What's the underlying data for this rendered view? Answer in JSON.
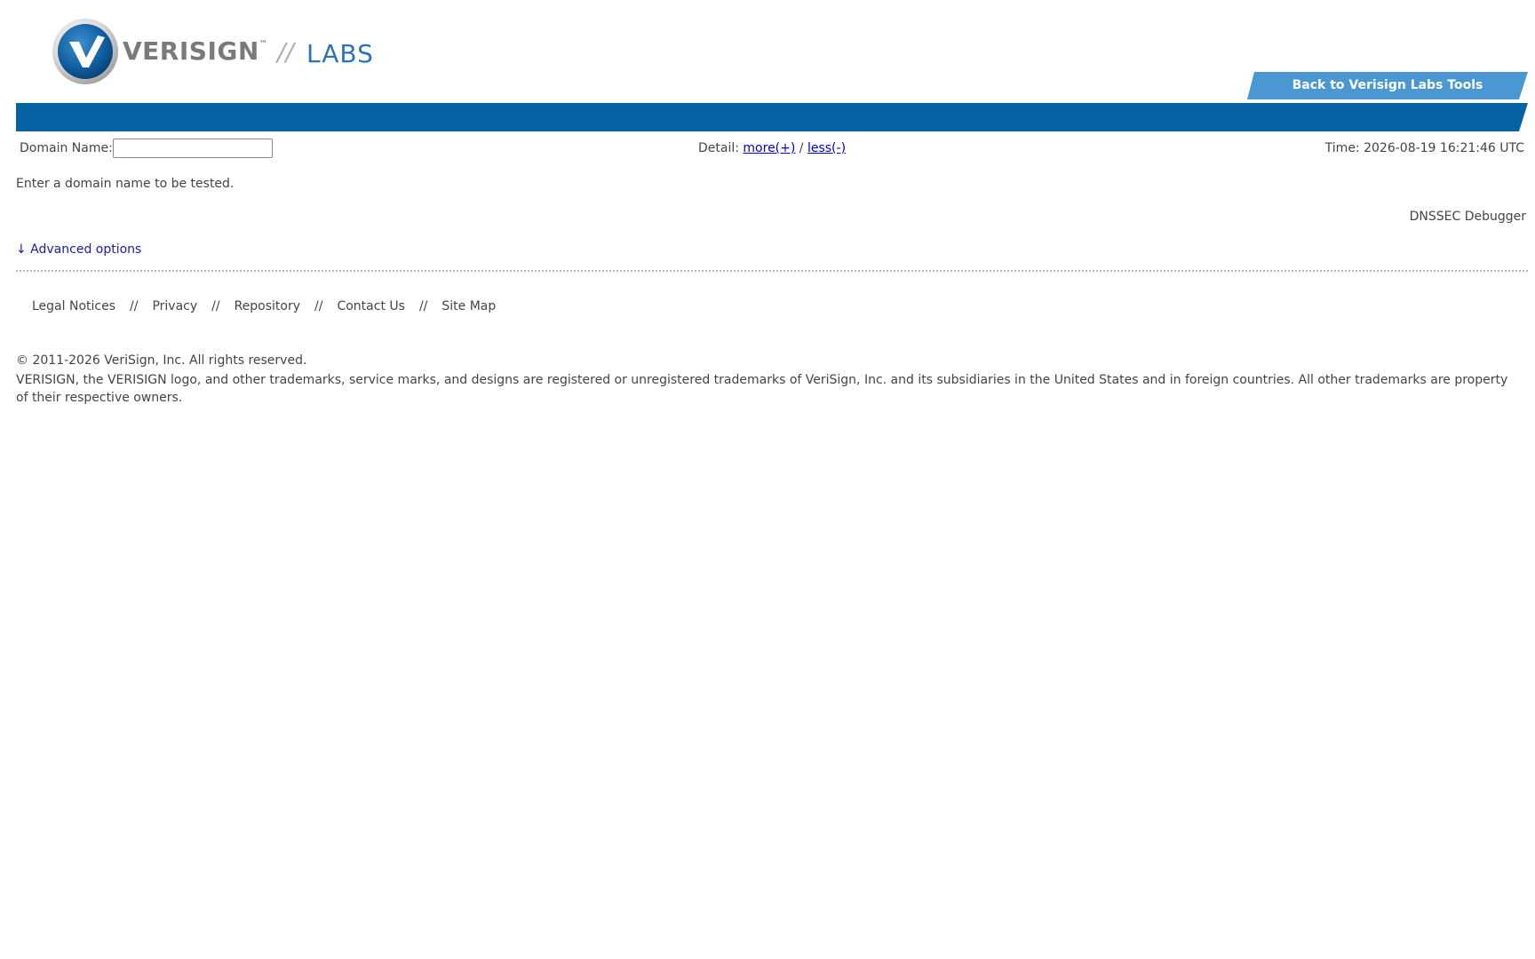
{
  "header": {
    "logo_word": "VERISIGN",
    "logo_tm": "™",
    "logo_separator": "//",
    "logo_labs": "LABS",
    "back_button_label": "Back to Verisign Labs Tools"
  },
  "form": {
    "domain_label": "Domain Name:",
    "domain_value": "",
    "domain_placeholder": "",
    "detail_label": "Detail:",
    "more_link": "more(+)",
    "detail_slash": "/",
    "less_link": "less(-)",
    "time_text": "Time: 2026-08-19 16:21:46 UTC"
  },
  "main": {
    "hint": "Enter a domain name to be tested.",
    "tool_name": "DNSSEC Debugger",
    "advanced_options": "↓ Advanced options"
  },
  "footer": {
    "links": [
      "Legal Notices",
      "Privacy",
      "Repository",
      "Contact Us",
      "Site Map"
    ],
    "separator": "//",
    "copyright": "© 2011-2026 VeriSign, Inc. All rights reserved.",
    "trademark": "VERISIGN, the VERISIGN logo, and other trademarks, service marks, and designs are registered or unregistered trademarks of VeriSign, Inc. and its subsidiaries in the United States and in foreign countries. All other trademarks are property of their respective owners."
  },
  "colors": {
    "brand_blue": "#0663a3",
    "button_blue": "#4a97d1",
    "labs_blue": "#2a74b3",
    "link_blue": "#0000cc"
  }
}
